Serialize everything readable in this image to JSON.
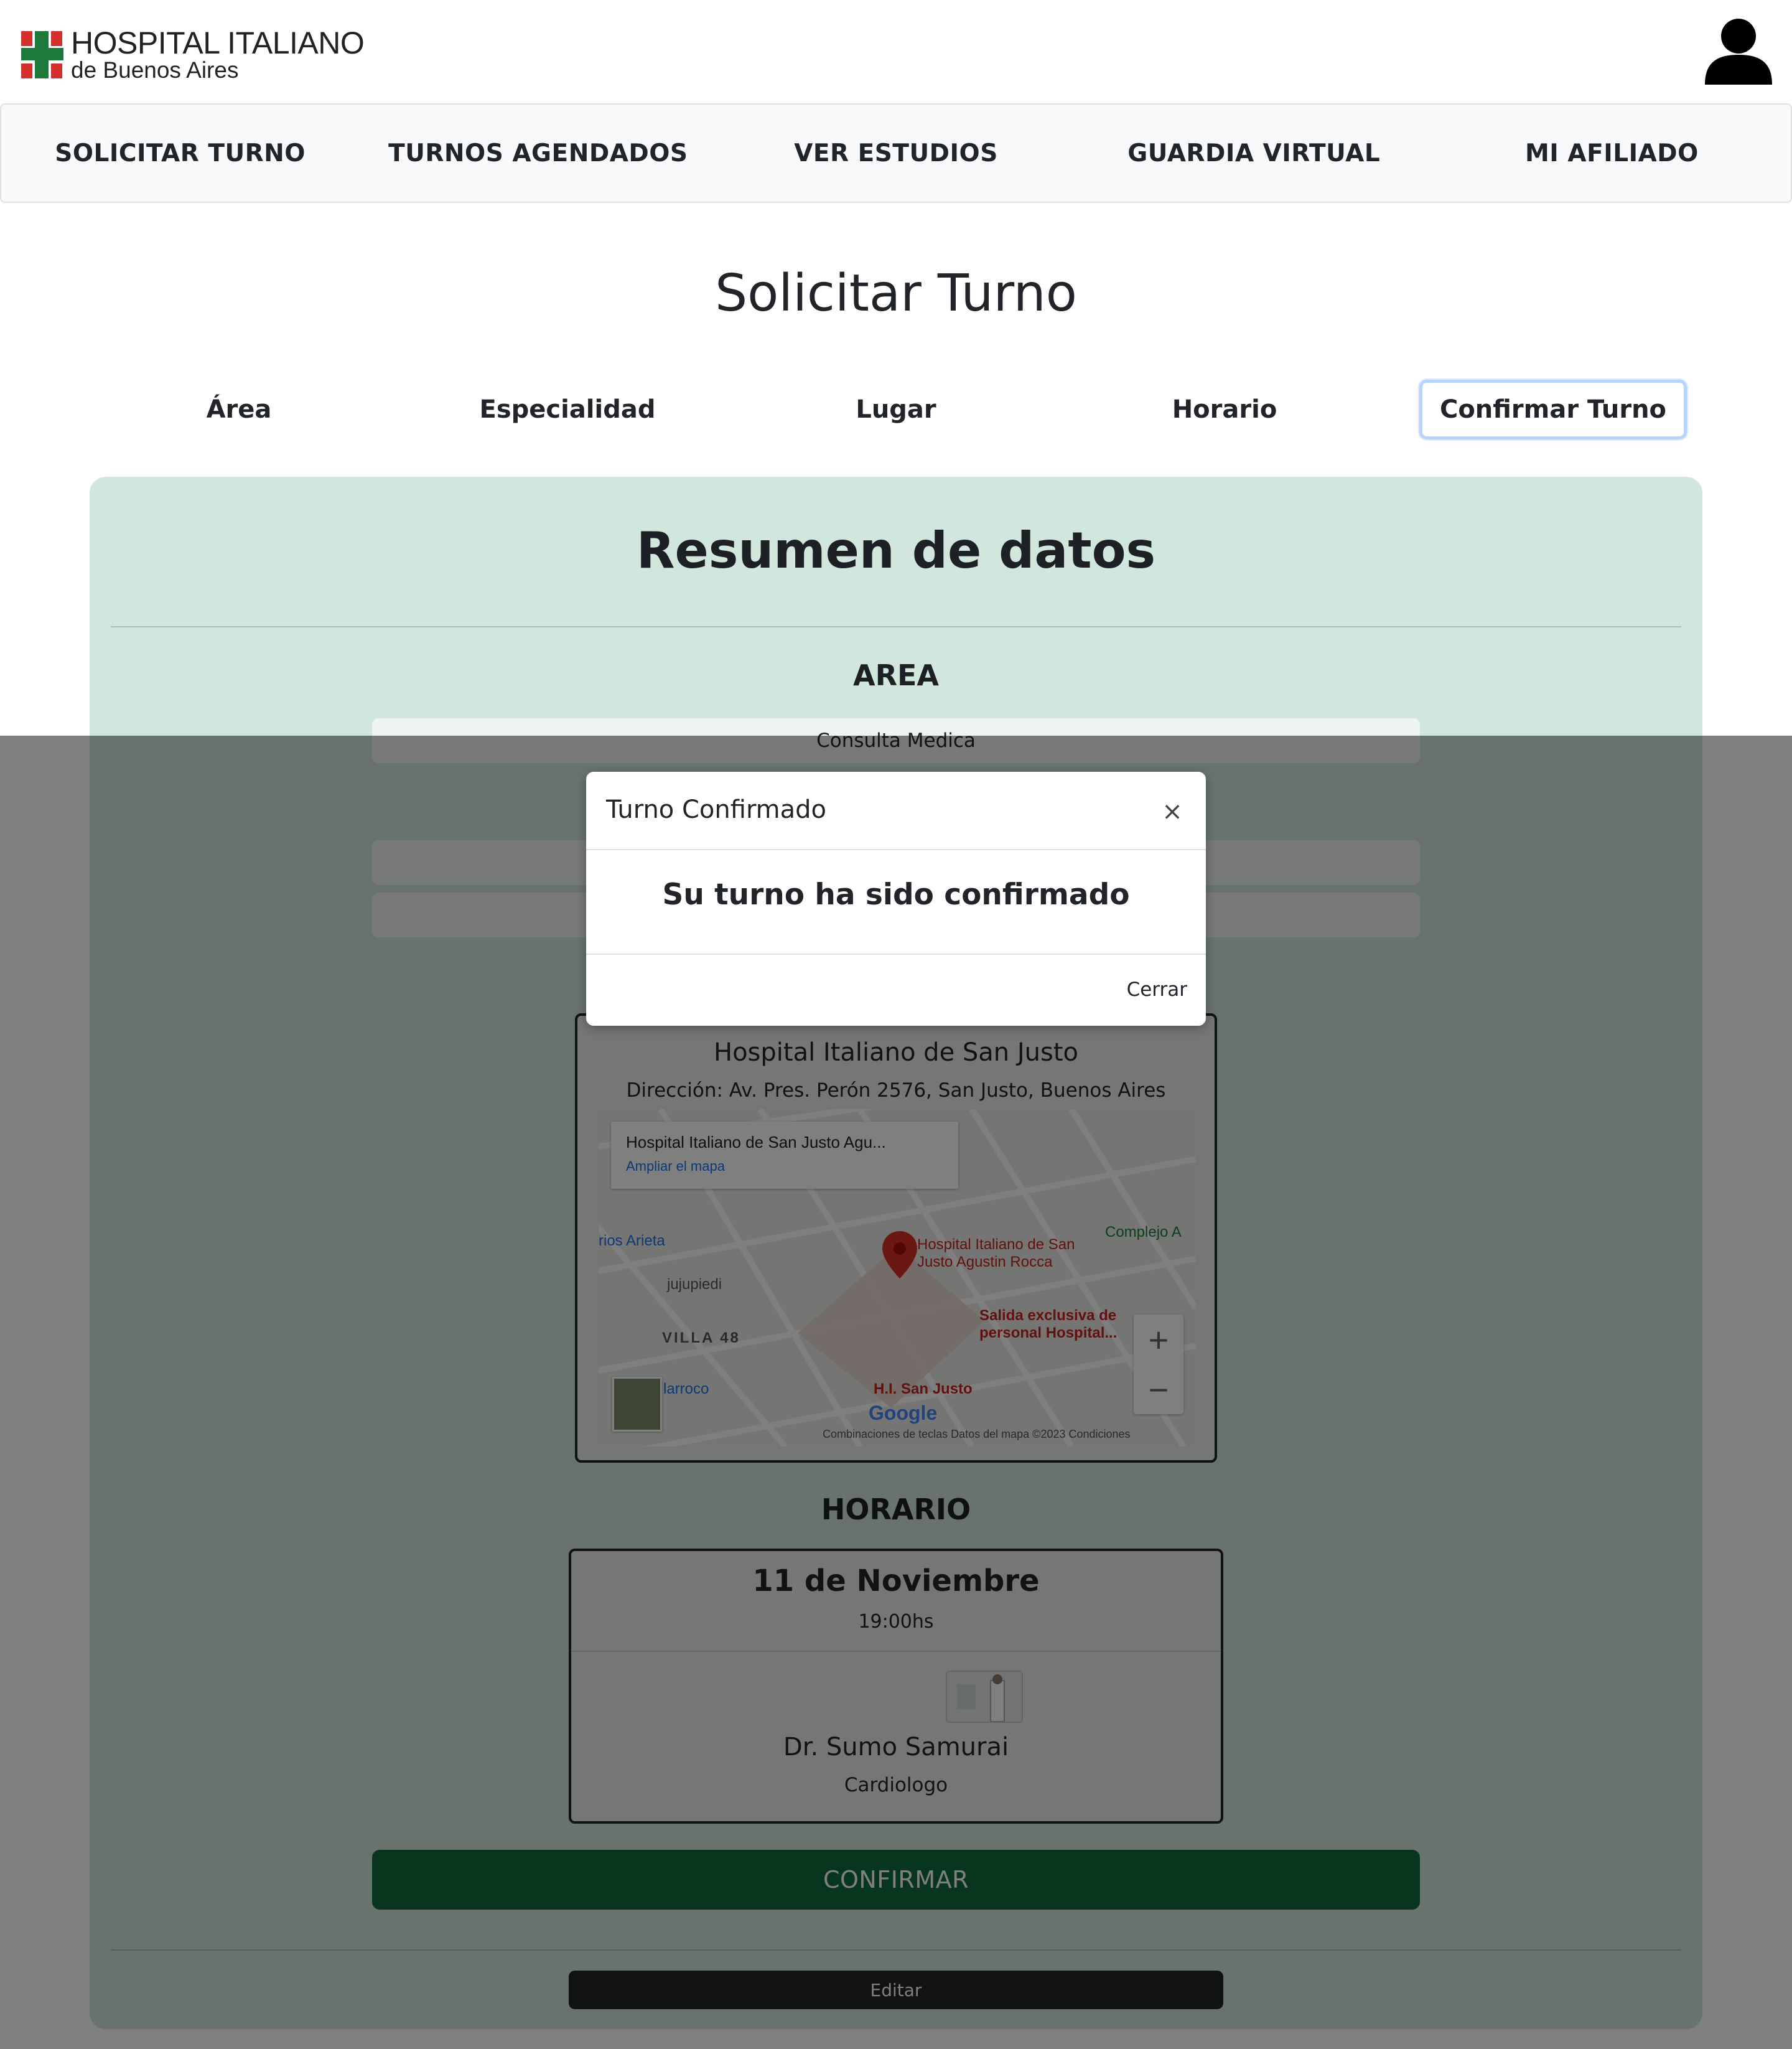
{
  "brand": {
    "line1": "HOSPITAL ITALIANO",
    "line2": "de Buenos Aires"
  },
  "user": {
    "icon": "user-icon"
  },
  "nav": [
    {
      "label": "SOLICITAR TURNO"
    },
    {
      "label": "TURNOS AGENDADOS"
    },
    {
      "label": "VER ESTUDIOS"
    },
    {
      "label": "GUARDIA VIRTUAL"
    },
    {
      "label": "MI AFILIADO"
    }
  ],
  "page": {
    "title": "Solicitar Turno"
  },
  "steps": [
    {
      "label": "Área"
    },
    {
      "label": "Especialidad"
    },
    {
      "label": "Lugar"
    },
    {
      "label": "Horario"
    },
    {
      "label": "Confirmar Turno"
    }
  ],
  "summary": {
    "title": "Resumen de datos",
    "area_label": "AREA",
    "area_value": "Consulta Medica",
    "place": {
      "name": "Hospital Italiano de San Justo",
      "address": "Dirección: Av. Pres. Perón 2576, San Justo, Buenos Aires"
    },
    "map": {
      "info_title": "Hospital Italiano de San Justo Agu...",
      "info_link": "Ampliar el mapa",
      "pin_label_1": "Hospital Italiano de San",
      "pin_label_2": "Justo Agustin Rocca",
      "poi_1a": "Salida exclusiva de",
      "poi_1b": "personal Hospital...",
      "poi_2": "H.I. San Justo",
      "area_1": "VILLA 48",
      "place_1": "jujupiedi",
      "place_2": "rios Arieta",
      "place_3": "larroco",
      "place_4": "Complejo A",
      "logo": "Google",
      "footer": "Combinaciones de teclas    Datos del mapa ©2023    Condiciones"
    },
    "schedule_label": "HORARIO",
    "schedule": {
      "date": "11 de Noviembre",
      "time": "19:00hs",
      "doctor": "Dr. Sumo Samurai",
      "specialty": "Cardiologo"
    },
    "confirm_label": "CONFIRMAR",
    "edit_label": "Editar"
  },
  "modal": {
    "title": "Turno Confirmado",
    "message": "Su turno ha sido confirmado",
    "close_label": "Cerrar"
  },
  "colors": {
    "summary_bg": "#d1e7dd",
    "confirm_bg": "#0f6b3d",
    "edit_bg": "#212529",
    "logo_green": "#1c7a3a",
    "logo_red": "#d32f2f"
  }
}
